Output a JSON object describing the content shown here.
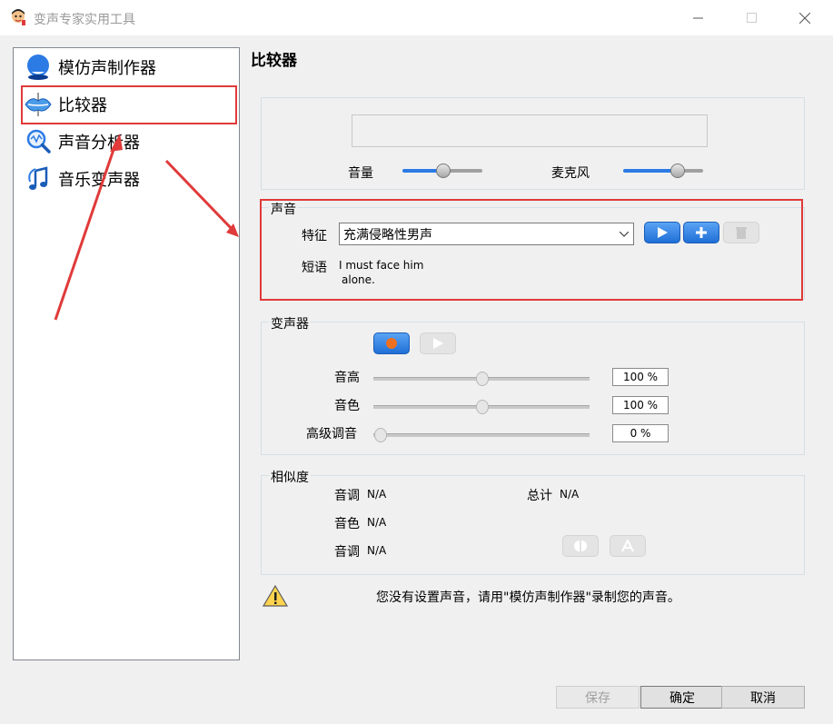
{
  "window": {
    "title": "变声专家实用工具",
    "controls": {
      "minimize": "minimize-icon",
      "maximize": "maximize-icon",
      "close": "close-icon"
    }
  },
  "sidebar": {
    "items": [
      {
        "label": "模仿声制作器",
        "icon": "face-icon"
      },
      {
        "label": "比较器",
        "icon": "lips-icon",
        "selected": true
      },
      {
        "label": "声音分析器",
        "icon": "magnifier-wave-icon"
      },
      {
        "label": "音乐变声器",
        "icon": "music-note-icon"
      }
    ]
  },
  "main": {
    "title": "比较器",
    "levels": {
      "volume_label": "音量",
      "volume_value": 0.5,
      "mic_label": "麦克风",
      "mic_value": 0.68
    },
    "voice": {
      "group_label": "声音",
      "feature_label": "特征",
      "feature_value": "充满侵略性男声",
      "phrase_label": "短语",
      "phrase_line1": "I must face him",
      "phrase_line2": "alone."
    },
    "changer": {
      "group_label": "变声器",
      "pitch_label": "音高",
      "pitch_value": "100 %",
      "timbre_label": "音色",
      "timbre_value": "100 %",
      "advanced_label": "高级调音",
      "advanced_value": "0 %"
    },
    "similarity": {
      "group_label": "相似度",
      "tone_label": "音调",
      "tone_value": "N/A",
      "timbre_label": "音色",
      "timbre_value": "N/A",
      "tone2_label": "音调",
      "tone2_value": "N/A",
      "total_label": "总计",
      "total_value": "N/A"
    },
    "warning": "您没有设置声音，请用\"模仿声制作器\"录制您的声音。"
  },
  "footer": {
    "save_label": "保存",
    "ok_label": "确定",
    "cancel_label": "取消"
  },
  "colors": {
    "accent": "#1f6fd6",
    "annotation": "#e03a3a"
  }
}
